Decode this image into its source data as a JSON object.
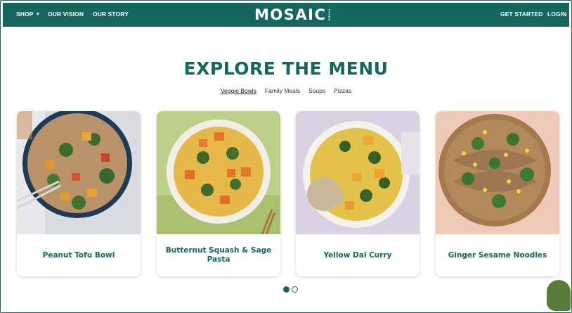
{
  "nav": {
    "shop": "SHOP",
    "vision": "OUR VISION",
    "story": "OUR STORY",
    "logo": "MOSAIC",
    "logo_sub": "FOODS",
    "get_started": "GET STARTED",
    "login": "LOGIN"
  },
  "header": {
    "title": "EXPLORE THE MENU",
    "tabs": [
      "Veggie Bowls",
      "Family Meals",
      "Soups",
      "Pizzas"
    ],
    "active_tab": "Veggie Bowls"
  },
  "cards": [
    {
      "name": "Peanut Tofu Bowl"
    },
    {
      "name": "Butternut Squash & Sage Pasta"
    },
    {
      "name": "Yellow Dal Curry"
    },
    {
      "name": "Ginger Sesame Noodles"
    }
  ],
  "carousel": {
    "pages": 2,
    "current_page": 1
  },
  "colors": {
    "brand": "#15665c",
    "accent_blob": "#5a7a3a"
  }
}
